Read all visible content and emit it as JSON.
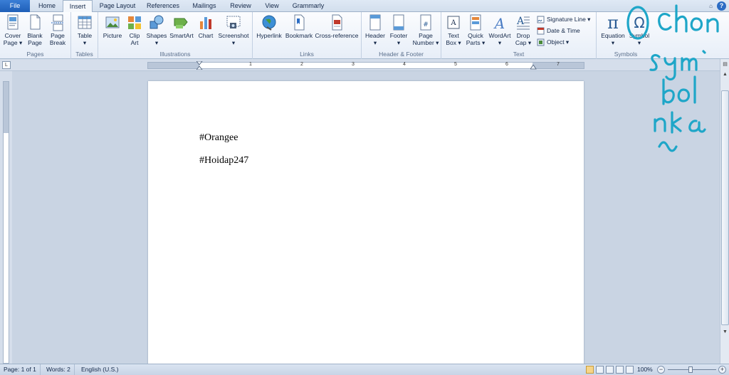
{
  "tabs": [
    {
      "label": "File",
      "name": "tab-file"
    },
    {
      "label": "Home",
      "name": "tab-home"
    },
    {
      "label": "Insert",
      "name": "tab-insert"
    },
    {
      "label": "Page Layout",
      "name": "tab-page-layout"
    },
    {
      "label": "References",
      "name": "tab-references"
    },
    {
      "label": "Mailings",
      "name": "tab-mailings"
    },
    {
      "label": "Review",
      "name": "tab-review"
    },
    {
      "label": "View",
      "name": "tab-view"
    },
    {
      "label": "Grammarly",
      "name": "tab-grammarly"
    }
  ],
  "active_tab": "Insert",
  "ribbon": {
    "pages": {
      "label": "Pages",
      "cover_page": "Cover\nPage ▾",
      "blank_page": "Blank\nPage",
      "page_break": "Page\nBreak"
    },
    "tables": {
      "label": "Tables",
      "table": "Table\n▾"
    },
    "illustrations": {
      "label": "Illustrations",
      "picture": "Picture",
      "clip_art": "Clip\nArt",
      "shapes": "Shapes\n▾",
      "smartart": "SmartArt",
      "chart": "Chart",
      "screenshot": "Screenshot\n▾"
    },
    "links": {
      "label": "Links",
      "hyperlink": "Hyperlink",
      "bookmark": "Bookmark",
      "cross_reference": "Cross-reference"
    },
    "header_footer": {
      "label": "Header & Footer",
      "header": "Header\n▾",
      "footer": "Footer\n▾",
      "page_number": "Page\nNumber ▾"
    },
    "text": {
      "label": "Text",
      "text_box": "Text\nBox ▾",
      "quick_parts": "Quick\nParts ▾",
      "wordart": "WordArt\n▾",
      "drop_cap": "Drop\nCap ▾",
      "signature_line": "Signature Line ▾",
      "date_time": "Date & Time",
      "object": "Object ▾"
    },
    "symbols": {
      "label": "Symbols",
      "equation": "Equation\n▾",
      "symbol": "Symbol\n▾"
    }
  },
  "icons": {
    "equation_glyph": "π",
    "symbol_glyph": "Ω",
    "help_glyph": "?",
    "ruler_toggle_glyph": "L"
  },
  "ruler_numbers": [
    "1",
    "2",
    "3",
    "4",
    "5",
    "6",
    "7"
  ],
  "document": {
    "lines": [
      "#Orangee",
      "#Hoidap247"
    ]
  },
  "status": {
    "page": "Page: 1 of 1",
    "words": "Words: 2",
    "language": "English (U.S.)",
    "zoom": "100%",
    "zoom_level_percent": 100
  },
  "colors": {
    "file_tab": "#2a6fc9",
    "annotation": "#1ea6c8",
    "ribbon_bg": "#f5f8fc"
  }
}
